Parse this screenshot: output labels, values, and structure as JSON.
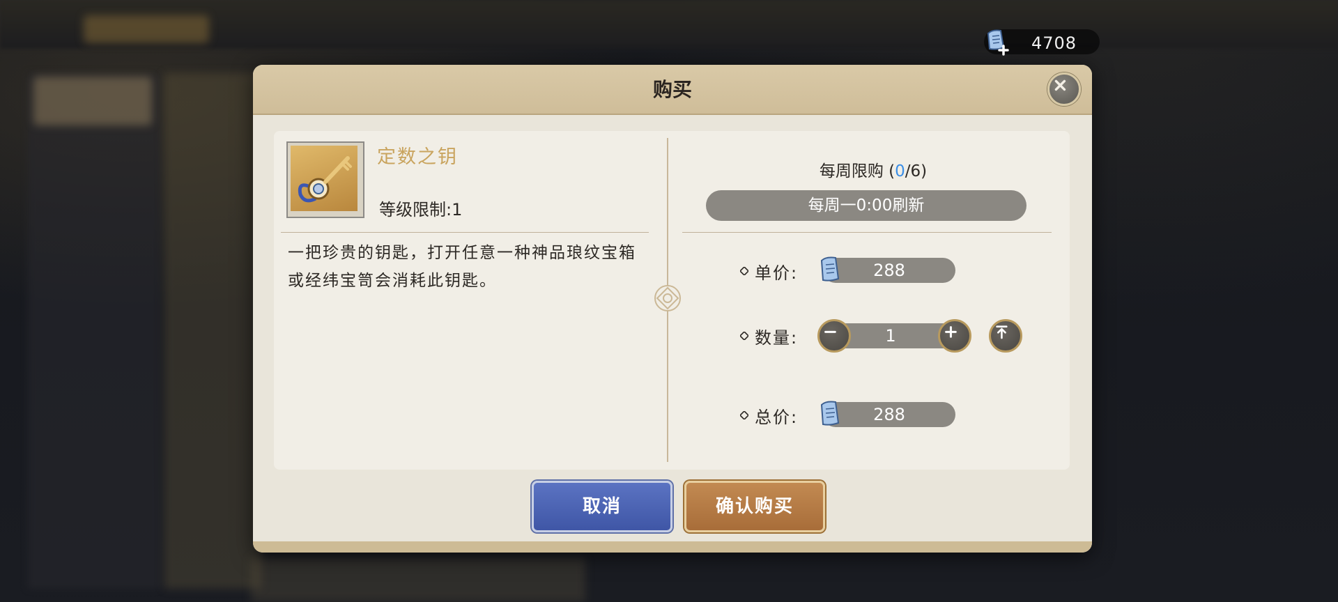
{
  "currency": {
    "icon": "scroll-ticket-icon",
    "value": "4708"
  },
  "dialog": {
    "title": "购买",
    "item": {
      "icon": "key-icon",
      "name": "定数之钥",
      "level_limit": "等级限制:1",
      "description": "一把珍贵的钥匙，打开任意一种神品琅纹宝箱或经纬宝笥会消耗此钥匙。"
    },
    "weekly_limit": {
      "label": "每周限购",
      "bought": "0",
      "max": "6"
    },
    "refresh_text": "每周一0:00刷新",
    "unit_price": {
      "label": "单价:",
      "value": "288"
    },
    "quantity": {
      "label": "数量:",
      "value": "1"
    },
    "total_price": {
      "label": "总价:",
      "value": "288"
    },
    "buttons": {
      "cancel": "取消",
      "confirm": "确认购买"
    }
  },
  "colors": {
    "dialog_bg": "#e9e5da",
    "header_bg": "#d9c9a7",
    "accent_gold": "#c9a45e",
    "count_blue": "#3b8ee6",
    "cancel_blue": "#4a62b3",
    "confirm_orange": "#b57a43"
  }
}
